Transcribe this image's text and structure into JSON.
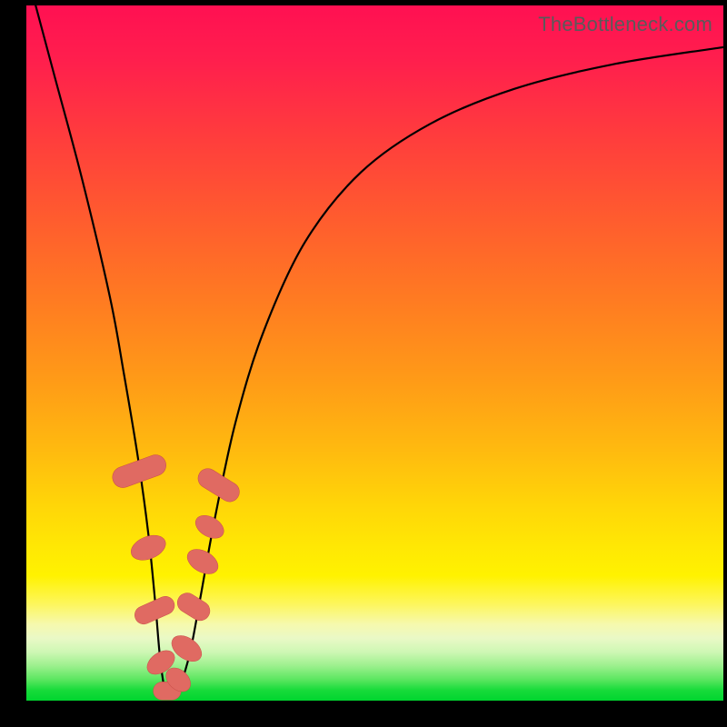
{
  "watermark": "TheBottleneck.com",
  "colors": {
    "bead_fill": "#e06a62",
    "bead_stroke": "#c94f49",
    "curve": "#000000"
  },
  "chart_data": {
    "type": "line",
    "title": "",
    "xlabel": "",
    "ylabel": "",
    "xlim": [
      0,
      100
    ],
    "ylim": [
      0,
      100
    ],
    "series": [
      {
        "name": "bottleneck-curve",
        "x": [
          0,
          4,
          8,
          12,
          14,
          16,
          17.5,
          18.5,
          19.2,
          20,
          21,
          22,
          23.5,
          25,
          27,
          30,
          34,
          40,
          48,
          58,
          70,
          84,
          100
        ],
        "values": [
          105,
          90,
          75,
          58,
          47,
          35,
          24,
          14,
          6,
          1,
          0.5,
          2,
          7,
          15,
          26,
          40,
          53,
          66,
          76,
          83,
          88,
          91.5,
          94
        ]
      }
    ],
    "markers": [
      {
        "shape": "rounded-rect",
        "x": 16.2,
        "y": 33,
        "w": 3.0,
        "h": 8.0,
        "angle": -70
      },
      {
        "shape": "ellipse",
        "x": 17.5,
        "y": 22,
        "rx": 1.6,
        "ry": 2.6,
        "angle": -68
      },
      {
        "shape": "rounded-rect",
        "x": 18.4,
        "y": 13,
        "w": 2.6,
        "h": 6.0,
        "angle": -66
      },
      {
        "shape": "ellipse",
        "x": 19.3,
        "y": 5.5,
        "rx": 1.4,
        "ry": 2.2,
        "angle": -55
      },
      {
        "shape": "rounded-rect",
        "x": 20.2,
        "y": 1.4,
        "w": 4.0,
        "h": 2.6,
        "angle": 0
      },
      {
        "shape": "ellipse",
        "x": 21.8,
        "y": 3.0,
        "rx": 1.4,
        "ry": 2.0,
        "angle": 48
      },
      {
        "shape": "ellipse",
        "x": 23.0,
        "y": 7.5,
        "rx": 1.5,
        "ry": 2.4,
        "angle": 55
      },
      {
        "shape": "rounded-rect",
        "x": 24.0,
        "y": 13.5,
        "w": 2.8,
        "h": 5.0,
        "angle": 58
      },
      {
        "shape": "ellipse",
        "x": 25.3,
        "y": 20.0,
        "rx": 1.5,
        "ry": 2.4,
        "angle": 60
      },
      {
        "shape": "ellipse",
        "x": 26.3,
        "y": 25.0,
        "rx": 1.4,
        "ry": 2.2,
        "angle": 60
      },
      {
        "shape": "rounded-rect",
        "x": 27.6,
        "y": 31.0,
        "w": 2.8,
        "h": 6.5,
        "angle": 58
      }
    ]
  }
}
